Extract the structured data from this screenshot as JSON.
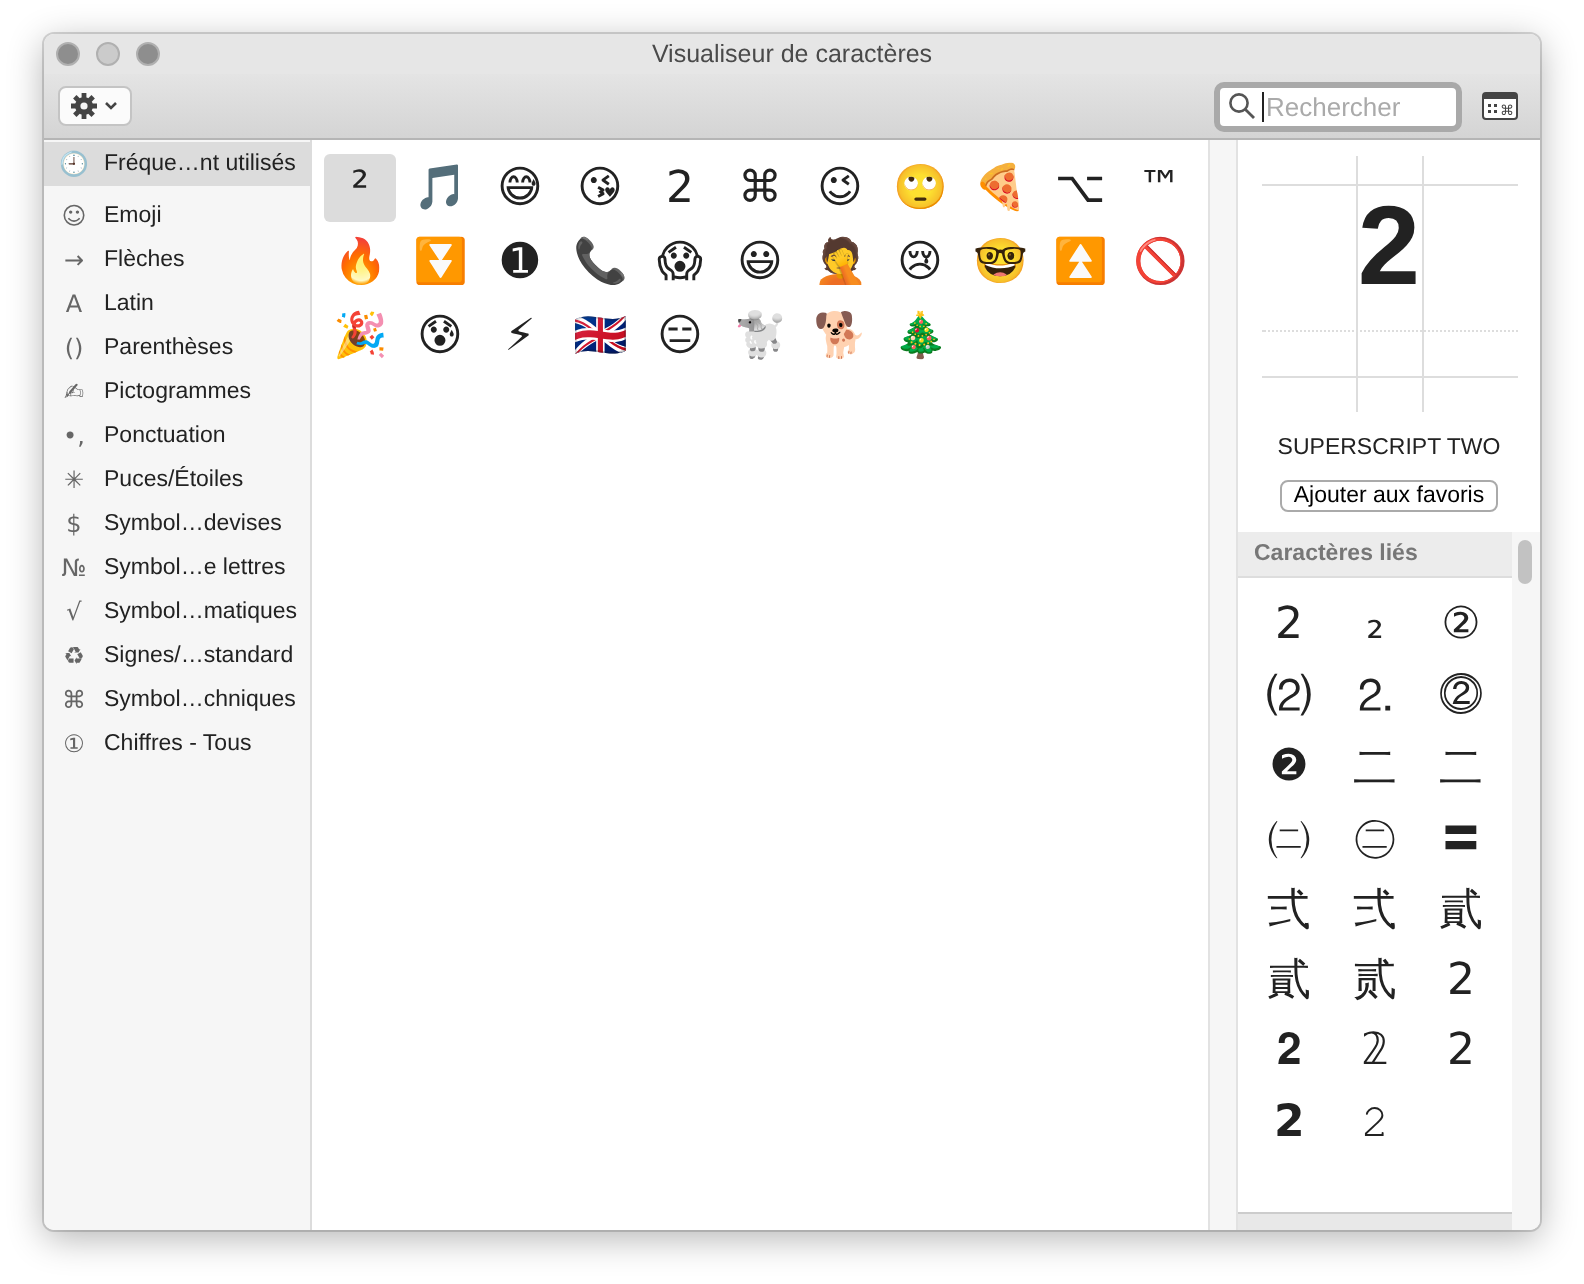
{
  "window": {
    "title": "Visualiseur de caractères"
  },
  "search": {
    "placeholder": "Rechercher"
  },
  "sidebar": {
    "items": [
      {
        "icon": "🕘",
        "label": "Fréque…nt utilisés",
        "selected": true
      },
      {
        "icon": "☺",
        "label": "Emoji",
        "selected": false
      },
      {
        "icon": "→",
        "label": "Flèches",
        "selected": false
      },
      {
        "icon": "A",
        "label": "Latin",
        "selected": false
      },
      {
        "icon": "()",
        "label": "Parenthèses",
        "selected": false
      },
      {
        "icon": "✍",
        "label": "Pictogrammes",
        "selected": false
      },
      {
        "icon": "•,",
        "label": "Ponctuation",
        "selected": false
      },
      {
        "icon": "✳",
        "label": "Puces/Étoiles",
        "selected": false
      },
      {
        "icon": "$",
        "label": "Symbol…devises",
        "selected": false
      },
      {
        "icon": "№",
        "label": "Symbol…e lettres",
        "selected": false
      },
      {
        "icon": "√",
        "label": "Symbol…matiques",
        "selected": false
      },
      {
        "icon": "♻",
        "label": "Signes/…standard",
        "selected": false
      },
      {
        "icon": "⌘",
        "label": "Symbol…chniques",
        "selected": false
      },
      {
        "icon": "①",
        "label": "Chiffres - Tous",
        "selected": false
      }
    ]
  },
  "characters": [
    {
      "char": "²",
      "selected": true
    },
    {
      "char": "🎵",
      "selected": false
    },
    {
      "char": "😅",
      "selected": false
    },
    {
      "char": "😘",
      "selected": false
    },
    {
      "char": "2",
      "selected": false
    },
    {
      "char": "⌘",
      "selected": false
    },
    {
      "char": "😉",
      "selected": false
    },
    {
      "char": "🙄",
      "selected": false
    },
    {
      "char": "🍕",
      "selected": false
    },
    {
      "char": "⌥",
      "selected": false
    },
    {
      "char": "™",
      "selected": false
    },
    {
      "char": "🔥",
      "selected": false
    },
    {
      "char": "⏬",
      "selected": false
    },
    {
      "char": "➊",
      "selected": false
    },
    {
      "char": "📞",
      "selected": false
    },
    {
      "char": "😱",
      "selected": false
    },
    {
      "char": "😃",
      "selected": false
    },
    {
      "char": "🤦",
      "selected": false
    },
    {
      "char": "😢",
      "selected": false
    },
    {
      "char": "🤓",
      "selected": false
    },
    {
      "char": "⏫",
      "selected": false
    },
    {
      "char": "🚫",
      "selected": false
    },
    {
      "char": "🎉",
      "selected": false
    },
    {
      "char": "😰",
      "selected": false
    },
    {
      "char": "⚡",
      "selected": false
    },
    {
      "char": "🇬🇧",
      "selected": false
    },
    {
      "char": "😑",
      "selected": false
    },
    {
      "char": "🐩",
      "selected": false
    },
    {
      "char": "🐕",
      "selected": false
    },
    {
      "char": "🎄",
      "selected": false
    }
  ],
  "preview": {
    "glyph": "2",
    "name": "SUPERSCRIPT TWO",
    "favorite_button": "Ajouter aux favoris"
  },
  "related": {
    "title": "Caractères liés",
    "characters": [
      "2",
      "₂",
      "②",
      "⑵",
      "⒉",
      "⓶",
      "❷",
      "二",
      "⼆",
      "㈡",
      "㊁",
      "〓",
      "弍",
      "弍",
      "貳",
      "貳",
      "贰",
      "2",
      "𝟐",
      "𝟚",
      "𝟤",
      "𝟮",
      "𝟸"
    ]
  }
}
